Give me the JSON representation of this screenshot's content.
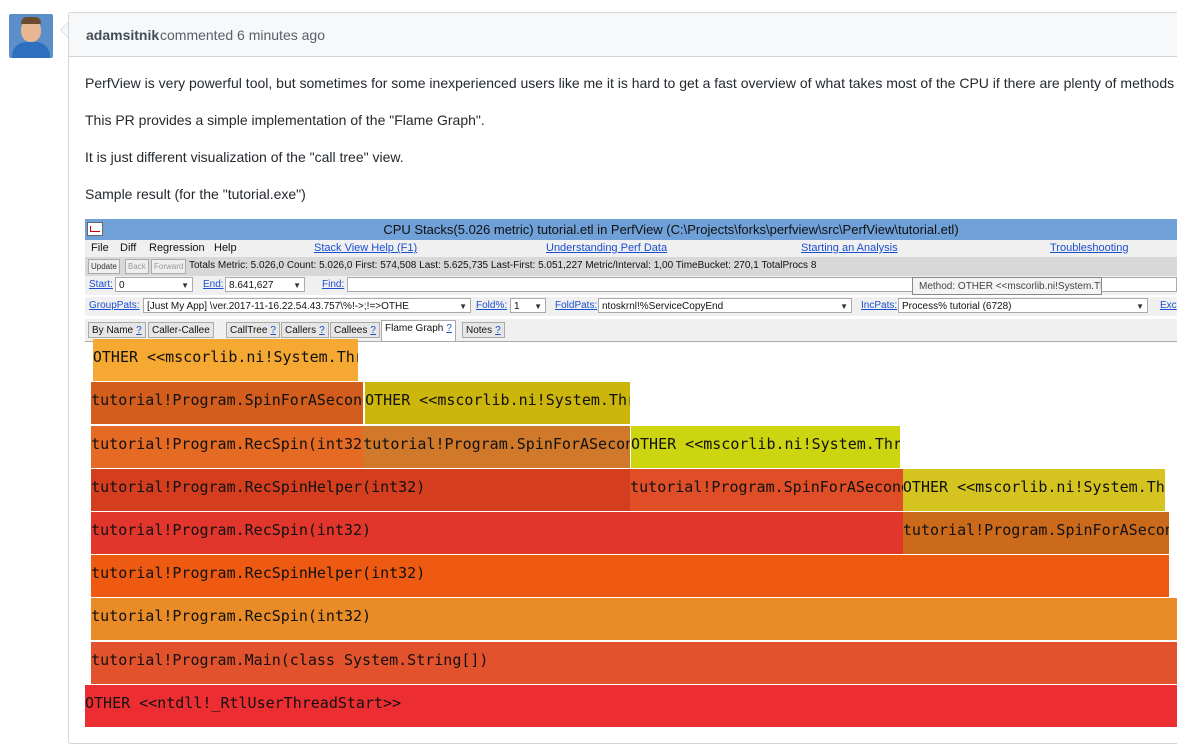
{
  "comment": {
    "author": "adamsitnik",
    "meta": "commented 6 minutes ago",
    "paragraphs": [
      "PerfView is very powerful tool, but sometimes for some inexperienced users like me it is hard to get a fast overview of what takes most of the CPU if there are plenty of methods c",
      "This PR provides a simple implementation of the \"Flame Graph\".",
      "It is just different visualization of the \"call tree\" view.",
      "Sample result (for the \"tutorial.exe\")"
    ]
  },
  "perfview": {
    "title": "CPU Stacks(5.026 metric) tutorial.etl in PerfView (C:\\Projects\\forks\\perfview\\src\\PerfView\\tutorial.etl)",
    "menu": [
      "File",
      "Diff",
      "Regression",
      "Help"
    ],
    "help_links": [
      "Stack View Help (F1)",
      "Understanding Perf Data",
      "Starting an Analysis",
      "Troubleshooting"
    ],
    "buttons": [
      "Update",
      "Back",
      "Forward"
    ],
    "totals": "Totals Metric: 5.026,0  Count: 5.026,0  First: 574,508 Last: 5.625,735  Last-First: 5.051,227  Metric/Interval: 1,00  TimeBucket: 270,1  TotalProcs 8",
    "start_label": "Start:",
    "start_value": "0",
    "end_label": "End:",
    "end_value": "8.641,627",
    "find_label": "Find:",
    "grouppats_label": "GroupPats:",
    "grouppats_value": "[Just My App]          \\ver.2017-11-16.22.54.43.757\\%!->;!=>OTHE",
    "foldpct_label": "Fold%:",
    "foldpct_value": "1",
    "foldpats_label": "FoldPats:",
    "foldpats_value": "ntoskrnl!%ServiceCopyEnd",
    "incpats_label": "IncPats:",
    "incpats_value": "Process% tutorial (6728)",
    "excpats_label": "Exc",
    "tabs": [
      "By Name",
      "Caller-Callee",
      "CallTree",
      "Callers",
      "Callees",
      "Flame Graph",
      "Notes"
    ],
    "tab_help": "?",
    "tooltip": "Method: OTHER <<mscorlib.ni!System.Threading.Thread.Sleep"
  },
  "flame_graph": {
    "frames": [
      {
        "label": "OTHER <<mscorlib.ni!System.Threading.Thread.Sleep>>",
        "level": 8,
        "start": 0.0072,
        "end": 0.25,
        "color": "#f5a832"
      },
      {
        "label": "tutorial!Program.SpinForASecond()",
        "level": 7,
        "start": 0.0056,
        "end": 0.2548,
        "color": "#d25d1d"
      },
      {
        "label": "OTHER <<mscorlib.ni!System.Threading.Thread.Sleep>>",
        "level": 7,
        "start": 0.2565,
        "end": 0.4992,
        "color": "#ccb60b"
      },
      {
        "label": "tutorial!Program.RecSpin(int32)",
        "level": 6,
        "start": 0.0056,
        "end": 0.2548,
        "color": "#e56a23"
      },
      {
        "label": "tutorial!Program.SpinForASecond()",
        "level": 6,
        "start": 0.2548,
        "end": 0.4992,
        "color": "#d1792b"
      },
      {
        "label": "OTHER <<mscorlib.ni!System.Threading.Thread.Sleep>>",
        "level": 6,
        "start": 0.5,
        "end": 0.7464,
        "color": "#ccd510"
      },
      {
        "label": "tutorial!Program.RecSpinHelper(int32)",
        "level": 5,
        "start": 0.0056,
        "end": 0.4992,
        "color": "#d43e1e"
      },
      {
        "label": "tutorial!Program.SpinForASecond()",
        "level": 5,
        "start": 0.4992,
        "end": 0.749,
        "color": "#e04e28"
      },
      {
        "label": "OTHER <<mscorlib.ni!System.Threading.Thread.Sleep>>",
        "level": 5,
        "start": 0.749,
        "end": 0.989,
        "color": "#d5c420"
      },
      {
        "label": "tutorial!Program.RecSpin(int32)",
        "level": 4,
        "start": 0.0056,
        "end": 0.749,
        "color": "#e2362c"
      },
      {
        "label": "tutorial!Program.SpinForASecond()",
        "level": 4,
        "start": 0.749,
        "end": 0.993,
        "color": "#cc6a1c"
      },
      {
        "label": "tutorial!Program.RecSpinHelper(int32)",
        "level": 3,
        "start": 0.0056,
        "end": 0.993,
        "color": "#ef5a12"
      },
      {
        "label": "tutorial!Program.RecSpin(int32)",
        "level": 2,
        "start": 0.0056,
        "end": 1.0,
        "color": "#e98c27"
      },
      {
        "label": "tutorial!Program.Main(class System.String[])",
        "level": 1,
        "start": 0.0056,
        "end": 1.0,
        "color": "#e2532d"
      },
      {
        "label": "OTHER <<ntdll!_RtlUserThreadStart>>",
        "level": 0,
        "start": 0.0,
        "end": 1.0,
        "color": "#ec2e32"
      }
    ]
  }
}
